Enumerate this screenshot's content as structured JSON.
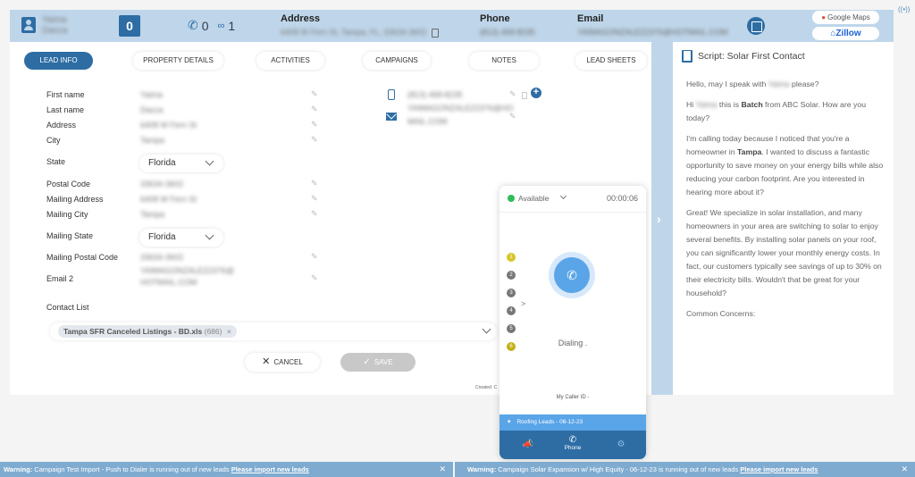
{
  "header": {
    "lead_name_line1": "Yaima",
    "lead_name_line2": "Dacca",
    "counter": "0",
    "calls_count": "0",
    "voicemail_count": "1",
    "address_label": "Address",
    "address_value": "6408 W Fern St, Tampa, FL, 33634-3602",
    "phone_label": "Phone",
    "phone_value": "(813) 468-8235",
    "email_label": "Email",
    "email_value": "YAIMAGONZALEZ2376@HOTMAIL.COM",
    "google_maps_label": "Google Maps",
    "zillow_label": "Zillow"
  },
  "tabs": [
    {
      "label": "LEAD INFO",
      "active": true
    },
    {
      "label": "PROPERTY DETAILS",
      "active": false
    },
    {
      "label": "ACTIVITIES",
      "active": false
    },
    {
      "label": "CAMPAIGNS",
      "active": false
    },
    {
      "label": "NOTES",
      "active": false
    },
    {
      "label": "LEAD SHEETS",
      "active": false
    }
  ],
  "fields": {
    "first_name": {
      "label": "First name",
      "value": "Yaima"
    },
    "last_name": {
      "label": "Last name",
      "value": "Dacca"
    },
    "address": {
      "label": "Address",
      "value": "6408 W Fern St"
    },
    "city": {
      "label": "City",
      "value": "Tampa"
    },
    "state": {
      "label": "State",
      "value": "Florida"
    },
    "postal_code": {
      "label": "Postal Code",
      "value": "33634-3602"
    },
    "mailing_address": {
      "label": "Mailing Address",
      "value": "6408 W Fern St"
    },
    "mailing_city": {
      "label": "Mailing City",
      "value": "Tampa"
    },
    "mailing_state": {
      "label": "Mailing State",
      "value": "Florida"
    },
    "mailing_postal_code": {
      "label": "Mailing Postal Code",
      "value": "33634-3602"
    },
    "email2": {
      "label": "Email 2",
      "value_line1": "YAIMAGONZALEZ2376@",
      "value_line2": "HOTMAIL.COM"
    },
    "contact_list": {
      "label": "Contact List",
      "chip_name": "Tampa SFR Canceled Listings - BD.xls",
      "chip_count": "(686)",
      "chip_remove": "×"
    }
  },
  "contact": {
    "phone": "(813) 468-8235",
    "email_line1": "YAIMAGONZALEZ2376@HO",
    "email_line2": "MAIL.COM"
  },
  "actions": {
    "cancel_label": "CANCEL",
    "save_label": "SAVE",
    "created_label": "Created: C"
  },
  "script": {
    "title": "Script: Solar First Contact",
    "p1_pre": "Hello, may I speak with ",
    "p1_name": "Yaima",
    "p1_post": " please?",
    "p2_pre": "Hi ",
    "p2_name": "Yaima",
    "p2_mid": " this is ",
    "p2_agent": "Batch",
    "p2_post": " from ABC Solar. How are you today?",
    "p3_pre": "I'm calling today because I noticed that you're a homeowner in ",
    "p3_city": "Tampa",
    "p3_post": ". I wanted to discuss a fantastic opportunity to save money on your energy bills while also reducing your carbon footprint. Are you interested in hearing more about it?",
    "p4": "Great! We specialize in solar installation, and many homeowners in your area are switching to solar to enjoy several benefits. By installing solar panels on your roof, you can significantly lower your monthly energy costs. In fact, our customers typically see savings of up to 30% on their electricity bills. Wouldn't that be great for your household?",
    "p5": "Common Concerns:"
  },
  "dialer": {
    "status": "Available",
    "status_color": "#2ebd59",
    "timer": "00:00:06",
    "queue": [
      "1",
      "2",
      "3",
      "4",
      "5",
      "6"
    ],
    "dialing_text": "Dialing .",
    "caller_id": "My Caller ID -",
    "campaign": "Roofing Leads - 06-12-23",
    "nav_phone_label": "Phone"
  },
  "warnings": [
    {
      "prefix": "Warning:",
      "text": " Campaign Test Import - Push to Dialer is running out of new leads ",
      "link": "Please import new leads"
    },
    {
      "prefix": "Warning:",
      "text": " Campaign Solar Expansion w/ High Equity - 06-12-23 is running out of new leads ",
      "link": "Please import new leads"
    }
  ],
  "colors": {
    "accent": "#2e6da4",
    "header_bg": "#bfd6ea",
    "warning_bg": "#7fabd0"
  }
}
